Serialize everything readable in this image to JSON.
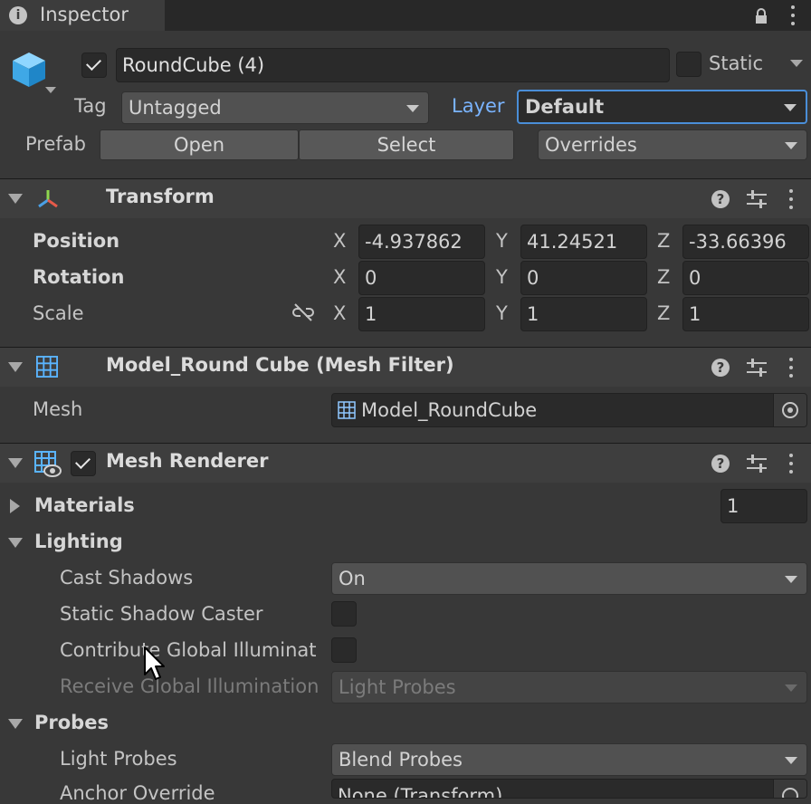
{
  "tab": {
    "title": "Inspector"
  },
  "object": {
    "name": "RoundCube (4)",
    "active": true,
    "static_label": "Static",
    "static_checked": false
  },
  "tag_row": {
    "tag_label": "Tag",
    "tag_value": "Untagged",
    "layer_label": "Layer",
    "layer_value": "Default"
  },
  "prefab_row": {
    "label": "Prefab",
    "open": "Open",
    "select": "Select",
    "overrides": "Overrides"
  },
  "transform": {
    "title": "Transform",
    "position": {
      "label": "Position",
      "x": "-4.937862",
      "y": "41.24521",
      "z": "-33.66396"
    },
    "rotation": {
      "label": "Rotation",
      "x": "0",
      "y": "0",
      "z": "0"
    },
    "scale": {
      "label": "Scale",
      "x": "1",
      "y": "1",
      "z": "1"
    },
    "axes": {
      "x": "X",
      "y": "Y",
      "z": "Z"
    }
  },
  "mesh_filter": {
    "title": "Model_Round Cube (Mesh Filter)",
    "mesh_label": "Mesh",
    "mesh_value": "Model_RoundCube"
  },
  "mesh_renderer": {
    "title": "Mesh Renderer",
    "enabled": true,
    "materials": {
      "label": "Materials",
      "count": "1"
    },
    "lighting": {
      "label": "Lighting",
      "cast_shadows_label": "Cast Shadows",
      "cast_shadows_value": "On",
      "static_shadow_label": "Static Shadow Caster",
      "contribute_gi_label": "Contribute Global Illuminat",
      "receive_gi_label": "Receive Global Illumination",
      "receive_gi_value": "Light Probes"
    },
    "probes": {
      "label": "Probes",
      "light_probes_label": "Light Probes",
      "light_probes_value": "Blend Probes",
      "anchor_label": "Anchor Override",
      "anchor_value": "None (Transform)"
    }
  },
  "colors": {
    "background": "#383838",
    "layer_accent": "#7ab4ff",
    "field": "#2a2a2a",
    "header": "#3e3e3e"
  }
}
